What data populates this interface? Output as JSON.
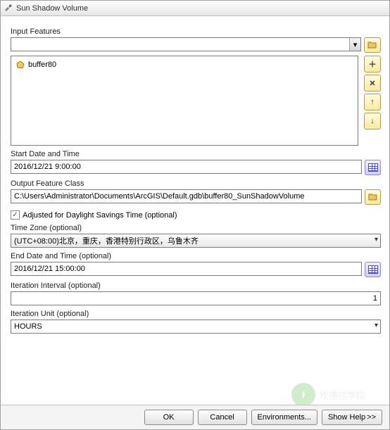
{
  "window": {
    "title": "Sun Shadow Volume"
  },
  "labels": {
    "input_features": "Input Features",
    "start_date": "Start Date and Time",
    "output_fc": "Output Feature Class",
    "adjust_dst": "Adjusted for Daylight Savings Time (optional)",
    "timezone": "Time Zone (optional)",
    "end_date": "End Date and Time (optional)",
    "iter_interval": "Iteration Interval (optional)",
    "iter_unit": "Iteration Unit (optional)"
  },
  "values": {
    "feature_item": "buffer80",
    "start_date": "2016/12/21 9:00:00",
    "output_fc": "C:\\Users\\Administrator\\Documents\\ArcGIS\\Default.gdb\\buffer80_SunShadowVolume",
    "timezone": "(UTC+08:00)北京，重庆，香港特别行政区，乌鲁木齐",
    "end_date": "2016/12/21 15:00:00",
    "iter_interval": "1",
    "iter_unit": "HOURS",
    "dst_checked": "✓"
  },
  "buttons": {
    "ok": "OK",
    "cancel": "Cancel",
    "environments": "Environments...",
    "show_help": "Show Help",
    "expand": ">>"
  },
  "chart_data": null
}
